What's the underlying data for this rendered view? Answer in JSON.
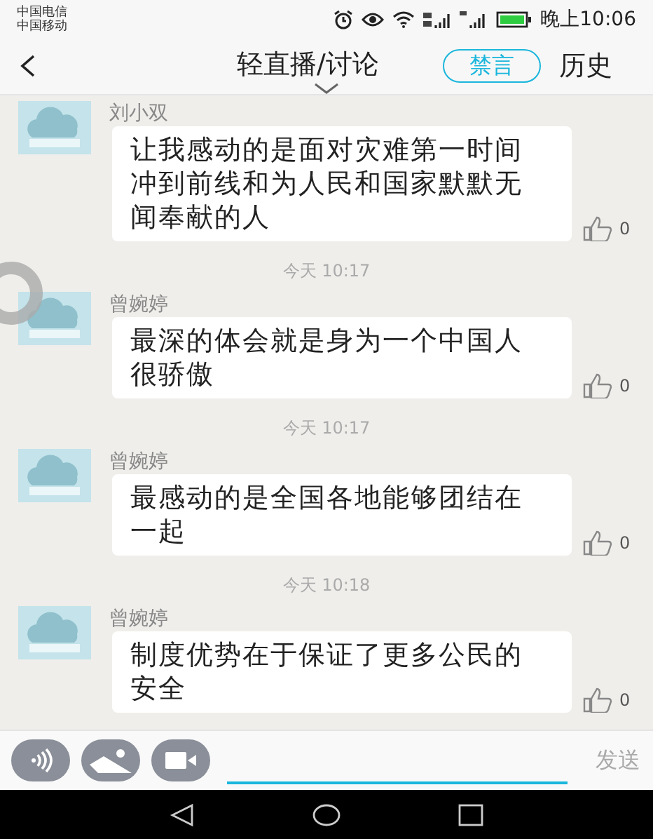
{
  "status_bar": {
    "carriers": [
      "中国电信",
      "中国移动"
    ],
    "time": "晚上10:06"
  },
  "header": {
    "title": "轻直播/讨论",
    "mute_button": "禁言",
    "history": "历史"
  },
  "feed": [
    {
      "kind": "message",
      "name": "刘小双",
      "text": "让我感动的是面对灾难第一时间冲到前线和为人民和国家默默无闻奉献的人",
      "likes": "0"
    },
    {
      "kind": "time",
      "text": "今天 10:17"
    },
    {
      "kind": "message",
      "name": "曾婉婷",
      "text": "最深的体会就是身为一个中国人很骄傲",
      "likes": "0"
    },
    {
      "kind": "time",
      "text": "今天 10:17"
    },
    {
      "kind": "message",
      "name": "曾婉婷",
      "text": "最感动的是全国各地能够团结在一起",
      "likes": "0"
    },
    {
      "kind": "time",
      "text": "今天 10:18"
    },
    {
      "kind": "message",
      "name": "曾婉婷",
      "text": "制度优势在于保证了更多公民的安全",
      "likes": "0"
    }
  ],
  "composer": {
    "send": "发送"
  }
}
